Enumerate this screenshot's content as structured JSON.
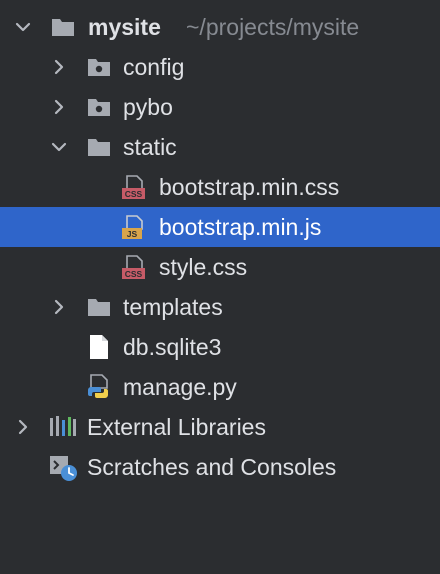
{
  "tree": {
    "root": {
      "name": "mysite",
      "path": "~/projects/mysite",
      "icon": "folder-icon",
      "expanded": true
    },
    "items": [
      {
        "label": "config",
        "icon": "package-folder-icon",
        "expanded": false
      },
      {
        "label": "pybo",
        "icon": "package-folder-icon",
        "expanded": false
      },
      {
        "label": "static",
        "icon": "folder-icon",
        "expanded": true
      },
      {
        "label": "bootstrap.min.css",
        "icon": "css-file-icon"
      },
      {
        "label": "bootstrap.min.js",
        "icon": "js-file-icon",
        "selected": true
      },
      {
        "label": "style.css",
        "icon": "css-file-icon"
      },
      {
        "label": "templates",
        "icon": "folder-icon",
        "expanded": false
      },
      {
        "label": "db.sqlite3",
        "icon": "file-icon"
      },
      {
        "label": "manage.py",
        "icon": "python-file-icon"
      },
      {
        "label": "External Libraries",
        "icon": "libraries-icon",
        "expanded": false
      },
      {
        "label": "Scratches and Consoles",
        "icon": "scratches-icon"
      }
    ]
  },
  "colors": {
    "background": "#2b2d30",
    "selection": "#2f65ca",
    "text": "#dfe1e5",
    "path_text": "#868a91",
    "folder": "#a6aab1",
    "css_badge": "#c65b67",
    "js_badge": "#d9a54b"
  }
}
